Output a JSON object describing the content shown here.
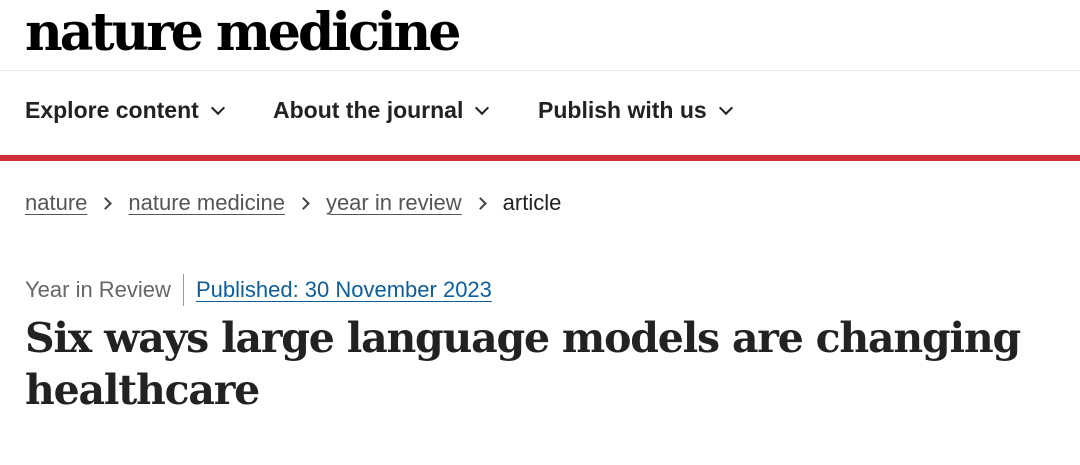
{
  "header": {
    "logo_text": "nature medicine"
  },
  "nav": {
    "items": [
      {
        "label": "Explore content"
      },
      {
        "label": "About the journal"
      },
      {
        "label": "Publish with us"
      }
    ]
  },
  "breadcrumb": {
    "items": [
      "nature",
      "nature medicine",
      "year in review"
    ],
    "current": "article"
  },
  "article": {
    "type": "Year in Review",
    "published": "Published: 30 November 2023",
    "title": "Six ways large language models are changing healthcare"
  },
  "colors": {
    "accent_bar": "#cc2f36",
    "link": "#0e5d99"
  }
}
